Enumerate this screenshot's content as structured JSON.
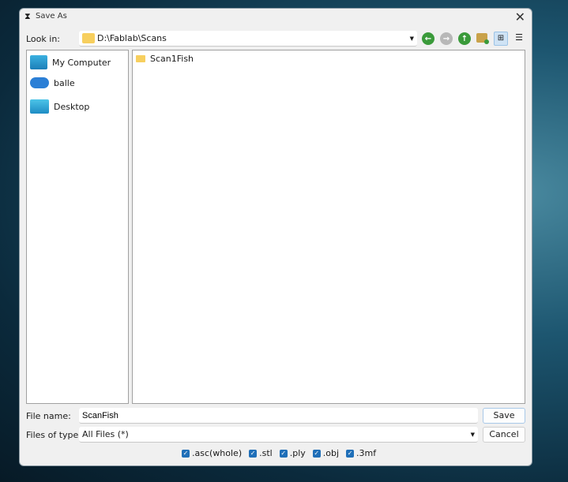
{
  "window": {
    "title": "Save As",
    "close_icon": "close-icon"
  },
  "look_in": {
    "label": "Look in:",
    "path": "D:\\Fablab\\Scans"
  },
  "toolbar": {
    "icons": [
      "back-icon",
      "forward-icon",
      "parent-folder-icon",
      "new-folder-icon",
      "list-view-icon",
      "detail-view-icon"
    ]
  },
  "sidebar": {
    "items": [
      {
        "label": "My Computer",
        "icon": "computer-icon"
      },
      {
        "label": "balle",
        "icon": "cloud-icon"
      },
      {
        "label": "Desktop",
        "icon": "desktop-icon"
      }
    ]
  },
  "files": [
    {
      "name": "Scan1Fish",
      "icon": "folder-icon"
    }
  ],
  "file_name": {
    "label": "File name:",
    "value": "ScanFish"
  },
  "file_type": {
    "label": "Files of type:",
    "value": "All Files (*)"
  },
  "buttons": {
    "save": "Save",
    "cancel": "Cancel"
  },
  "checkboxes": [
    {
      "label": ".asc(whole)",
      "checked": true
    },
    {
      "label": ".stl",
      "checked": true
    },
    {
      "label": ".ply",
      "checked": true
    },
    {
      "label": ".obj",
      "checked": true
    },
    {
      "label": ".3mf",
      "checked": true
    }
  ],
  "colors": {
    "accent": "#1f6fb8",
    "nav_green": "#3a9a3a"
  }
}
